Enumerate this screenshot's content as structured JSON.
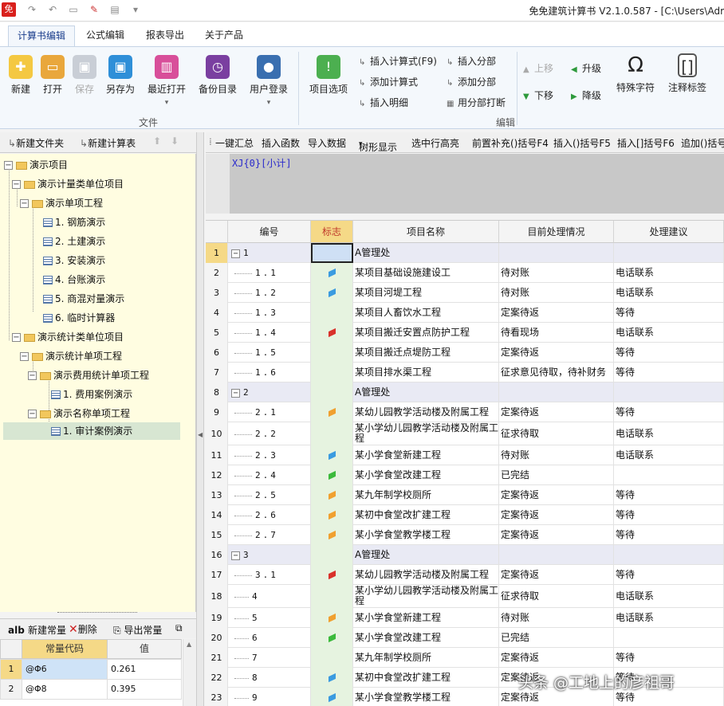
{
  "window": {
    "app_icon": "免",
    "title": "免免建筑计算书 V2.1.0.587 - [C:\\Users\\Adr"
  },
  "tabs": [
    "计算书编辑",
    "公式编辑",
    "报表导出",
    "关于产品"
  ],
  "ribbon": {
    "file_buttons": [
      "新建",
      "打开",
      "保存",
      "另存为",
      "最近打开",
      "备份目录",
      "用户登录"
    ],
    "file_group": "文件",
    "edit_main": "项目选项",
    "edit_small": [
      "插入计算式(F9)",
      "添加计算式",
      "插入明细",
      "插入分部",
      "添加分部",
      "用分部打断"
    ],
    "move": [
      "上移",
      "下移",
      "升级",
      "降级"
    ],
    "special_char": "特殊字符",
    "annotate": "注释标签",
    "edit_group": "编辑"
  },
  "left_toolbar": {
    "new_folder": "新建文件夹",
    "new_calc": "新建计算表"
  },
  "tree": [
    {
      "label": "演示项目",
      "level": 0,
      "type": "folder",
      "toggle": "−"
    },
    {
      "label": "演示计量类单位项目",
      "level": 1,
      "type": "folder",
      "toggle": "−"
    },
    {
      "label": "演示单项工程",
      "level": 2,
      "type": "folder",
      "toggle": "−"
    },
    {
      "label": "1. 钢筋演示",
      "level": 3,
      "type": "doc"
    },
    {
      "label": "2. 土建演示",
      "level": 3,
      "type": "doc"
    },
    {
      "label": "3. 安装演示",
      "level": 3,
      "type": "doc"
    },
    {
      "label": "4. 台账演示",
      "level": 3,
      "type": "doc"
    },
    {
      "label": "5. 商混对量演示",
      "level": 3,
      "type": "doc"
    },
    {
      "label": "6. 临时计算器",
      "level": 3,
      "type": "doc"
    },
    {
      "label": "演示统计类单位项目",
      "level": 1,
      "type": "folder",
      "toggle": "−"
    },
    {
      "label": "演示统计单项工程",
      "level": 2,
      "type": "folder",
      "toggle": "−"
    },
    {
      "label": "演示费用统计单项工程",
      "level": 3,
      "type": "folder",
      "toggle": "−"
    },
    {
      "label": "1. 费用案例演示",
      "level": 4,
      "type": "doc"
    },
    {
      "label": "演示名称单项工程",
      "level": 3,
      "type": "folder",
      "toggle": "−"
    },
    {
      "label": "1. 审计案例演示",
      "level": 4,
      "type": "doc",
      "selected": true
    }
  ],
  "constants": {
    "toolbar": {
      "new": "新建常量",
      "delete": "删除",
      "export": "导出常量"
    },
    "headers": [
      "常量代码",
      "值"
    ],
    "rows": [
      {
        "n": "1",
        "code": "@Φ6",
        "value": "0.261"
      },
      {
        "n": "2",
        "code": "@Φ8",
        "value": "0.395"
      }
    ]
  },
  "right_toolbar": [
    "一键汇总",
    "插入函数",
    "导入数据",
    "树形显示",
    "选中行高亮",
    "前置补充()括号F4",
    "插入()括号F5",
    "插入[]括号F6",
    "追加()括号"
  ],
  "formula": {
    "text": "XJ{0}[小计]"
  },
  "grid": {
    "headers": [
      "编号",
      "标志",
      "项目名称",
      "目前处理情况",
      "处理建议"
    ],
    "rows": [
      {
        "n": "1",
        "code": "1",
        "group": true,
        "flag": "",
        "name": "A管理处",
        "status": "",
        "advice": ""
      },
      {
        "n": "2",
        "code": "1.1",
        "flag": "blue",
        "name": "某项目基础设施建设工",
        "status": "待对账",
        "advice": "电话联系"
      },
      {
        "n": "3",
        "code": "1.2",
        "flag": "blue",
        "name": "某项目河堤工程",
        "status": "待对账",
        "advice": "电话联系"
      },
      {
        "n": "4",
        "code": "1.3",
        "flag": "",
        "name": "某项目人畜饮水工程",
        "status": "定案待返",
        "advice": "等待"
      },
      {
        "n": "5",
        "code": "1.4",
        "flag": "red",
        "name": "某项目搬迁安置点防护工程",
        "status": "待看现场",
        "advice": "电话联系"
      },
      {
        "n": "6",
        "code": "1.5",
        "flag": "",
        "name": "某项目搬迁点堤防工程",
        "status": "定案待返",
        "advice": "等待"
      },
      {
        "n": "7",
        "code": "1.6",
        "flag": "",
        "name": "某项目排水渠工程",
        "status": "征求意见待取，待补财务",
        "advice": "等待"
      },
      {
        "n": "8",
        "code": "2",
        "group": true,
        "flag": "",
        "name": "A管理处",
        "status": "",
        "advice": ""
      },
      {
        "n": "9",
        "code": "2.1",
        "flag": "orange",
        "name": "某幼儿园教学活动楼及附属工程",
        "status": "定案待返",
        "advice": "等待"
      },
      {
        "n": "10",
        "code": "2.2",
        "flag": "",
        "name": "某小学幼儿园教学活动楼及附属工程",
        "status": "征求待取",
        "advice": "电话联系"
      },
      {
        "n": "11",
        "code": "2.3",
        "flag": "blue",
        "name": "某小学食堂新建工程",
        "status": "待对账",
        "advice": "电话联系"
      },
      {
        "n": "12",
        "code": "2.4",
        "flag": "green",
        "name": "某小学食堂改建工程",
        "status": "已完结",
        "advice": ""
      },
      {
        "n": "13",
        "code": "2.5",
        "flag": "orange",
        "name": "某九年制学校厕所",
        "status": "定案待返",
        "advice": "等待"
      },
      {
        "n": "14",
        "code": "2.6",
        "flag": "orange",
        "name": "某初中食堂改扩建工程",
        "status": "定案待返",
        "advice": "等待"
      },
      {
        "n": "15",
        "code": "2.7",
        "flag": "orange",
        "name": "某小学食堂教学楼工程",
        "status": "定案待返",
        "advice": "等待"
      },
      {
        "n": "16",
        "code": "3",
        "group": true,
        "flag": "",
        "name": "A管理处",
        "status": "",
        "advice": ""
      },
      {
        "n": "17",
        "code": "3.1",
        "flag": "red",
        "name": "某幼儿园教学活动楼及附属工程",
        "status": "定案待返",
        "advice": "等待"
      },
      {
        "n": "18",
        "code": "4",
        "flag": "",
        "name": "某小学幼儿园教学活动楼及附属工程",
        "status": "征求待取",
        "advice": "电话联系"
      },
      {
        "n": "19",
        "code": "5",
        "flag": "orange",
        "name": "某小学食堂新建工程",
        "status": "待对账",
        "advice": "电话联系"
      },
      {
        "n": "20",
        "code": "6",
        "flag": "green",
        "name": "某小学食堂改建工程",
        "status": "已完结",
        "advice": ""
      },
      {
        "n": "21",
        "code": "7",
        "flag": "",
        "name": "某九年制学校厕所",
        "status": "定案待返",
        "advice": "等待"
      },
      {
        "n": "22",
        "code": "8",
        "flag": "blue",
        "name": "某初中食堂改扩建工程",
        "status": "定案待返",
        "advice": "等待"
      },
      {
        "n": "23",
        "code": "9",
        "flag": "blue",
        "name": "某小学食堂教学楼工程",
        "status": "定案待返",
        "advice": "等待"
      }
    ]
  },
  "flag_colors": {
    "blue": "#3b9be0",
    "red": "#d9312b",
    "orange": "#f0a030",
    "green": "#3cba3c"
  },
  "watermark": "头条 @工地上的彦祖哥"
}
